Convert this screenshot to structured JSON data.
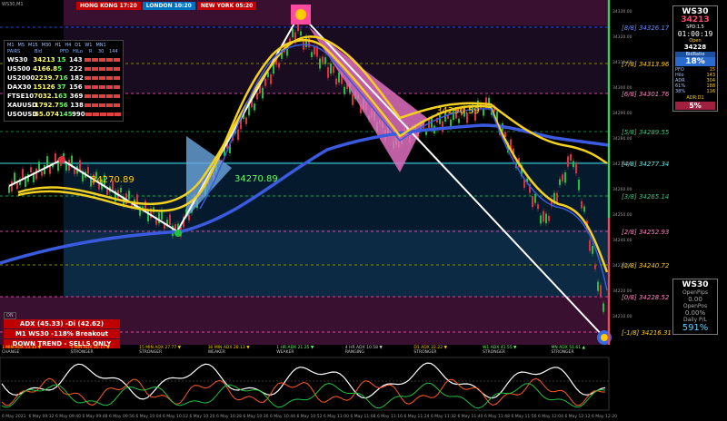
{
  "window": {
    "corner_label": "WS30,M1"
  },
  "sessions": [
    {
      "label": "HONG KONG 17:20",
      "cls": "hk"
    },
    {
      "label": "LONDON  10:20",
      "cls": "ld"
    },
    {
      "label": "NEW YORK  05:20",
      "cls": "ny"
    }
  ],
  "pairs_table": {
    "timeframes": [
      "M1",
      "M5",
      "M15",
      "M30",
      "H1",
      "H4",
      "D1",
      "W1",
      "MN1"
    ],
    "headers": [
      "PAIRS",
      "Bid",
      "PFD",
      "HiLo",
      "R",
      "30",
      "144"
    ],
    "rows": [
      {
        "name": "WS30",
        "bid": "34213",
        "pfd": "15",
        "hilo": "143"
      },
      {
        "name": "US500",
        "bid": "4166.8",
        "pfd": "5",
        "hilo": "222"
      },
      {
        "name": "US2000",
        "bid": "2239.7",
        "pfd": "16",
        "hilo": "182"
      },
      {
        "name": "DAX30",
        "bid": "15126",
        "pfd": "37",
        "hilo": "156"
      },
      {
        "name": "FTSE10",
        "bid": "7032.1",
        "pfd": "63",
        "hilo": "369"
      },
      {
        "name": "XAUUSD",
        "bid": "1792.7",
        "pfd": "56",
        "hilo": "138"
      },
      {
        "name": "USOUSD",
        "bid": "65.074",
        "pfd": "145",
        "hilo": "990"
      }
    ]
  },
  "info_panel": {
    "symbol": "WS30",
    "price": "34213",
    "spread": "SPD:1.5",
    "timer": "01:00:19",
    "open_label": "Open",
    "open_value": "34228",
    "bidratio_label": "BidRatio",
    "bidratio_value": "18%",
    "stats": [
      {
        "k": "PFO",
        "v": "15"
      },
      {
        "k": "Hilo",
        "v": "143"
      },
      {
        "k": "ADR",
        "v": "304"
      },
      {
        "k": "61%",
        "v": "188"
      },
      {
        "k": "38%",
        "v": "116"
      }
    ],
    "adr_d": "ADR:D1",
    "pct2": "5%"
  },
  "pips_panel": {
    "symbol": "WS30",
    "open_pips_label": "OpenPips",
    "open_pips_value": "0.00",
    "open_pos_label": "OpenPos",
    "open_pos_value": "0.00%",
    "daily_pl_label": "Daily P/L",
    "daily_pl_value": "591%"
  },
  "adx_box": {
    "on_label": "ON",
    "line1": "ADX (45.33) -Di (42.62)",
    "line2": "M1 WS30 -118% Breakout",
    "line3": "DOWN TREND - SELLS ONLY"
  },
  "adx_strip": [
    {
      "a": "1 MIN  ADX 53.33 ▼",
      "b": "CHANGE",
      "ac": "#ffcc00",
      "bc": "#ccc"
    },
    {
      "a": "5 MIN  ADX 35.17 ▼",
      "b": "STRONGER",
      "ac": "#ffcc00",
      "bc": "#ccc"
    },
    {
      "a": "15 MIN  ADX 27.77 ▼",
      "b": "STRONGER",
      "ac": "#ffcc00",
      "bc": "#ccc"
    },
    {
      "a": "30 MIN  ADX 28.13 ▼",
      "b": "WEAKER",
      "ac": "#ffcc00",
      "bc": "#ccc"
    },
    {
      "a": "1 HR  ADX 21.25 ▼",
      "b": "WEAKER",
      "ac": "#66ff66",
      "bc": "#ccc"
    },
    {
      "a": "4 HR  ADX 10.58 ▼",
      "b": "RANGING",
      "ac": "#ccc",
      "bc": "#ccc"
    },
    {
      "a": "D1  ADX 22.22 ▼",
      "b": "STRONGER",
      "ac": "#ffcc00",
      "bc": "#ccc"
    },
    {
      "a": "W1  ADX 41.55 ▼",
      "b": "STRONGER",
      "ac": "#66ff66",
      "bc": "#ccc"
    },
    {
      "a": "MN  ADX 51.61 ▲",
      "b": "STRONGER",
      "ac": "#66ff66",
      "bc": "#ccc"
    }
  ],
  "murrey_levels": [
    {
      "label": "[8/8]  34326.17"
    },
    {
      "label": "[7/8]  34313.96"
    },
    {
      "label": "[6/8]  34301.76"
    },
    {
      "label": "[5/8]  34289.55"
    },
    {
      "label": "[4/8]  34277.34"
    },
    {
      "label": "[3/8]  34265.14"
    },
    {
      "label": "[2/8]  34252.93"
    },
    {
      "label": "[1/8]  34240.72"
    },
    {
      "label": "[0/8]  34228.52"
    },
    {
      "label": "[-1/8]  34216.31"
    }
  ],
  "price_labels": [
    {
      "text": "34270.89",
      "color": "#ffcc00"
    },
    {
      "text": "34270.89",
      "color": "#66ff66"
    },
    {
      "text": "34290.59",
      "color": "#ffcc00"
    }
  ],
  "price_axis": [
    "34330.00",
    "34320.00",
    "34310.00",
    "34300.00",
    "34290.00",
    "34280.00",
    "34270.00",
    "34260.00",
    "34250.00",
    "34240.00",
    "34230.00",
    "34220.00",
    "34210.00"
  ],
  "time_axis": [
    "6 May 2021",
    "6 May 09:32",
    "6 May 09:40",
    "6 May 09:48",
    "6 May 09:56",
    "6 May 10:04",
    "6 May 10:12",
    "6 May 10:20",
    "6 May 10:28",
    "6 May 10:36",
    "6 May 10:44",
    "6 May 10:52",
    "6 May 11:00",
    "6 May 11:08",
    "6 May 11:16",
    "6 May 11:24",
    "6 May 11:32",
    "6 May 11:40",
    "6 May 11:48",
    "6 May 11:56",
    "6 May 12:04",
    "6 May 12:12",
    "6 May 12:20"
  ],
  "colors": {
    "zone_top": "#3a1030",
    "zone_mid": "#0c2a44",
    "zone_low": "#3a1030",
    "ema_blue": "#3a5adf",
    "ema_yellow": "#f4d020",
    "bull": "#22c040",
    "bear": "#e03040"
  }
}
